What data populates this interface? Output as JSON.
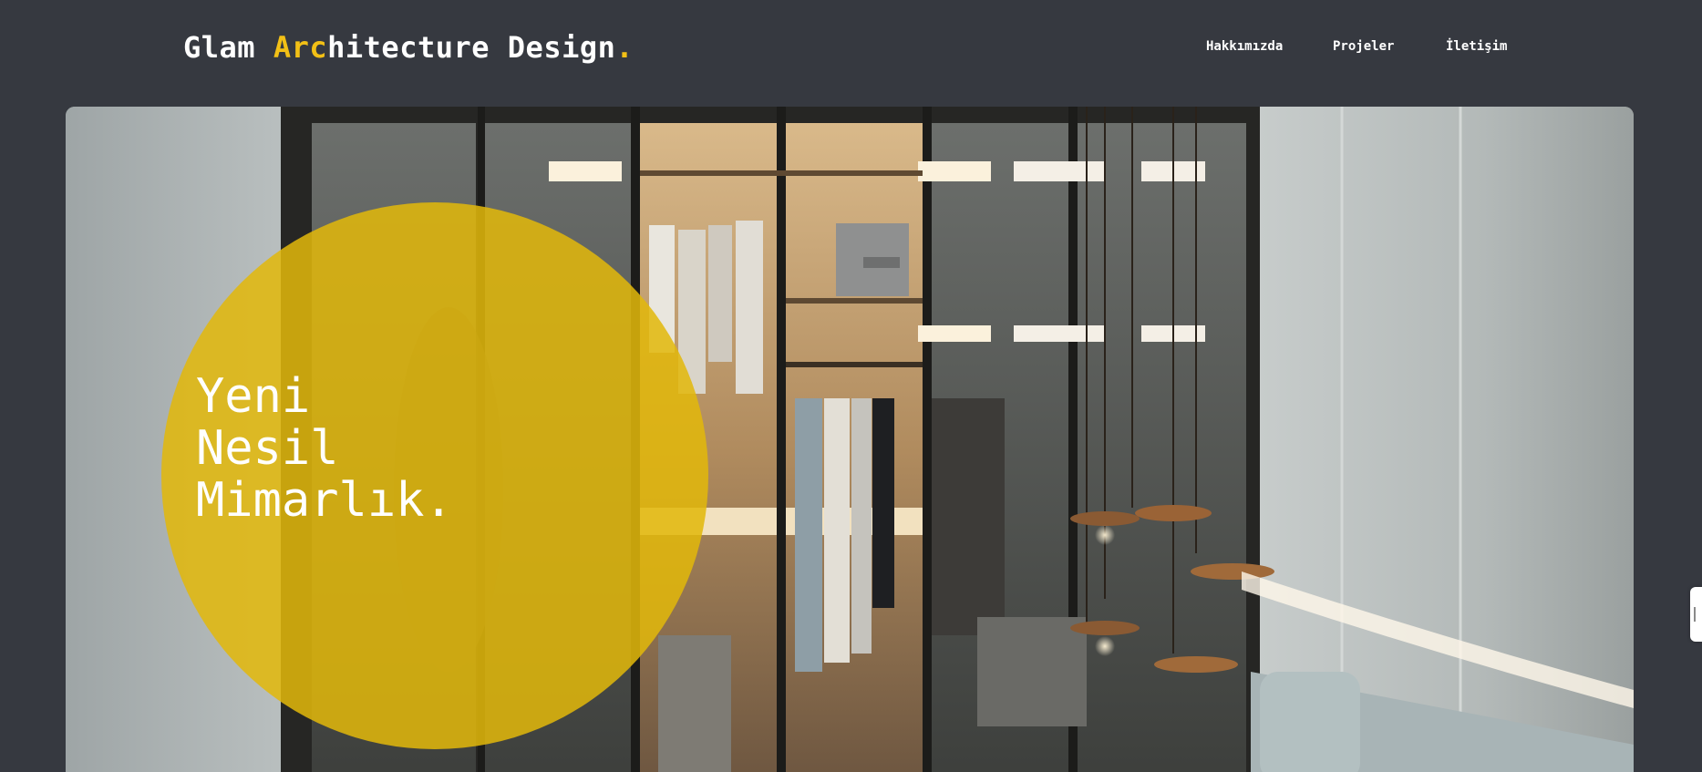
{
  "header": {
    "logo": {
      "part1": "Glam ",
      "accent": "Arc",
      "part2": "hitecture Design",
      "dot": "."
    },
    "nav": [
      {
        "label": "Hakkımızda"
      },
      {
        "label": "Projeler"
      },
      {
        "label": "İletişim"
      }
    ]
  },
  "hero": {
    "title_lines": [
      "Yeni",
      "Nesil",
      "Mimarlık."
    ],
    "image_subject": "walk-in glass wardrobe with pendant lights"
  },
  "colors": {
    "background": "#363940",
    "accent": "#f2c016",
    "circle": "#e2b80a",
    "text": "#ffffff"
  },
  "icons": {
    "side_tab": "feedback-tab-icon"
  }
}
